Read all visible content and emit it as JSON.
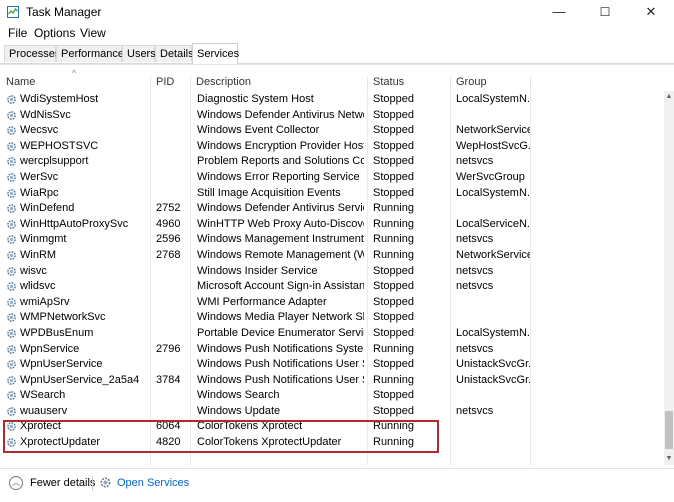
{
  "window": {
    "title": "Task Manager",
    "controls": [
      "—",
      "☐",
      "✕"
    ]
  },
  "menu": {
    "items": [
      "File",
      "Options",
      "View"
    ]
  },
  "tabs": [
    {
      "label": "Processes"
    },
    {
      "label": "Performance"
    },
    {
      "label": "Users"
    },
    {
      "label": "Details"
    },
    {
      "label": "Services",
      "active": true
    }
  ],
  "columns": {
    "name": "Name",
    "pid": "PID",
    "description": "Description",
    "status": "Status",
    "group": "Group"
  },
  "rows": [
    {
      "name": "WdiSystemHost",
      "pid": "",
      "description": "Diagnostic System Host",
      "status": "Stopped",
      "group": "LocalSystemN..."
    },
    {
      "name": "WdNisSvc",
      "pid": "",
      "description": "Windows Defender Antivirus Networ...",
      "status": "Stopped",
      "group": ""
    },
    {
      "name": "Wecsvc",
      "pid": "",
      "description": "Windows Event Collector",
      "status": "Stopped",
      "group": "NetworkService"
    },
    {
      "name": "WEPHOSTSVC",
      "pid": "",
      "description": "Windows Encryption Provider Host S...",
      "status": "Stopped",
      "group": "WepHostSvcG..."
    },
    {
      "name": "wercplsupport",
      "pid": "",
      "description": "Problem Reports and Solutions Cont...",
      "status": "Stopped",
      "group": "netsvcs"
    },
    {
      "name": "WerSvc",
      "pid": "",
      "description": "Windows Error Reporting Service",
      "status": "Stopped",
      "group": "WerSvcGroup"
    },
    {
      "name": "WiaRpc",
      "pid": "",
      "description": "Still Image Acquisition Events",
      "status": "Stopped",
      "group": "LocalSystemN..."
    },
    {
      "name": "WinDefend",
      "pid": "2752",
      "description": "Windows Defender Antivirus Service",
      "status": "Running",
      "group": ""
    },
    {
      "name": "WinHttpAutoProxySvc",
      "pid": "4960",
      "description": "WinHTTP Web Proxy Auto-Discover...",
      "status": "Running",
      "group": "LocalServiceN..."
    },
    {
      "name": "Winmgmt",
      "pid": "2596",
      "description": "Windows Management Instrumenta...",
      "status": "Running",
      "group": "netsvcs"
    },
    {
      "name": "WinRM",
      "pid": "2768",
      "description": "Windows Remote Management (WS...",
      "status": "Running",
      "group": "NetworkService"
    },
    {
      "name": "wisvc",
      "pid": "",
      "description": "Windows Insider Service",
      "status": "Stopped",
      "group": "netsvcs"
    },
    {
      "name": "wlidsvc",
      "pid": "",
      "description": "Microsoft Account Sign-in Assistant",
      "status": "Stopped",
      "group": "netsvcs"
    },
    {
      "name": "wmiApSrv",
      "pid": "",
      "description": "WMI Performance Adapter",
      "status": "Stopped",
      "group": ""
    },
    {
      "name": "WMPNetworkSvc",
      "pid": "",
      "description": "Windows Media Player Network Sha...",
      "status": "Stopped",
      "group": ""
    },
    {
      "name": "WPDBusEnum",
      "pid": "",
      "description": "Portable Device Enumerator Service",
      "status": "Stopped",
      "group": "LocalSystemN..."
    },
    {
      "name": "WpnService",
      "pid": "2796",
      "description": "Windows Push Notifications System ...",
      "status": "Running",
      "group": "netsvcs"
    },
    {
      "name": "WpnUserService",
      "pid": "",
      "description": "Windows Push Notifications User Se...",
      "status": "Stopped",
      "group": "UnistackSvcGr..."
    },
    {
      "name": "WpnUserService_2a5a4",
      "pid": "3784",
      "description": "Windows Push Notifications User Se...",
      "status": "Running",
      "group": "UnistackSvcGr..."
    },
    {
      "name": "WSearch",
      "pid": "",
      "description": "Windows Search",
      "status": "Stopped",
      "group": ""
    },
    {
      "name": "wuauserv",
      "pid": "",
      "description": "Windows Update",
      "status": "Stopped",
      "group": "netsvcs"
    },
    {
      "name": "Xprotect",
      "pid": "6064",
      "description": "ColorTokens Xprotect",
      "status": "Running",
      "group": ""
    },
    {
      "name": "XprotectUpdater",
      "pid": "4820",
      "description": "ColorTokens XprotectUpdater",
      "status": "Running",
      "group": ""
    }
  ],
  "highlight_color": "#b3282d",
  "footer": {
    "fewer_details": "Fewer details",
    "open_services": "Open Services"
  }
}
